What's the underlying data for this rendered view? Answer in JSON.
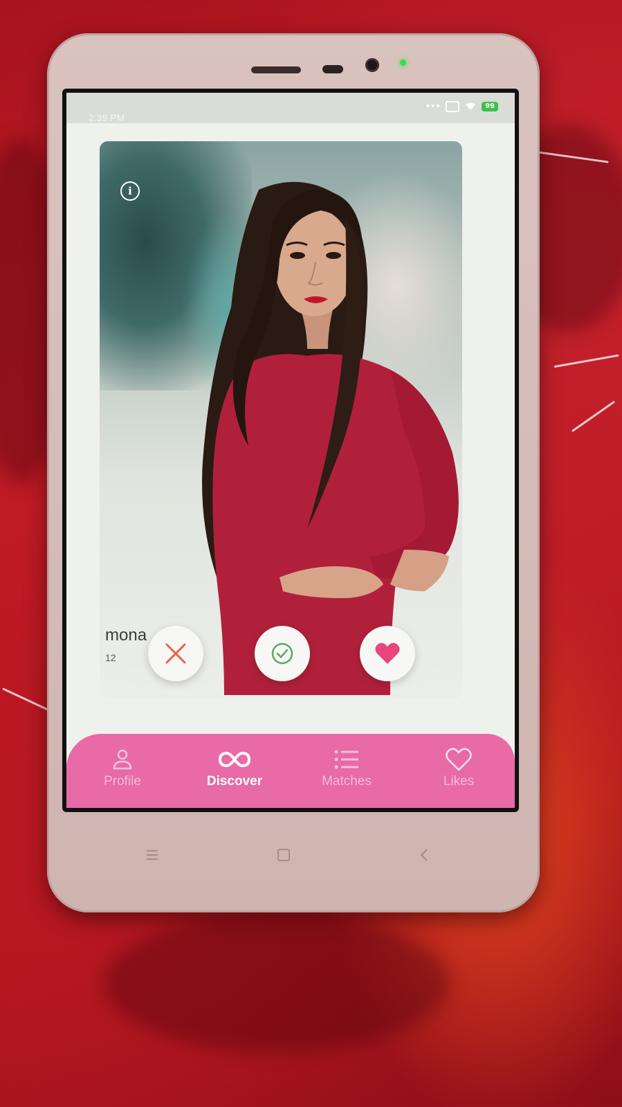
{
  "status_bar": {
    "time": "2:39 PM",
    "battery": "99"
  },
  "card": {
    "name": "mona",
    "age": "12"
  },
  "actions": {
    "dislike_icon": "close-icon",
    "accept_icon": "check-circle-icon",
    "like_icon": "heart-icon"
  },
  "bottom_nav": {
    "items": [
      {
        "label": "Profile",
        "icon": "person-icon",
        "active": false
      },
      {
        "label": "Discover",
        "icon": "infinity-icon",
        "active": true
      },
      {
        "label": "Matches",
        "icon": "list-icon",
        "active": false
      },
      {
        "label": "Likes",
        "icon": "heart-outline-icon",
        "active": false
      }
    ]
  },
  "colors": {
    "nav_background": "#e86aa6",
    "like_heart": "#e8457e",
    "dislike_x": "#e8644a",
    "accept_check": "#5aa86a"
  }
}
